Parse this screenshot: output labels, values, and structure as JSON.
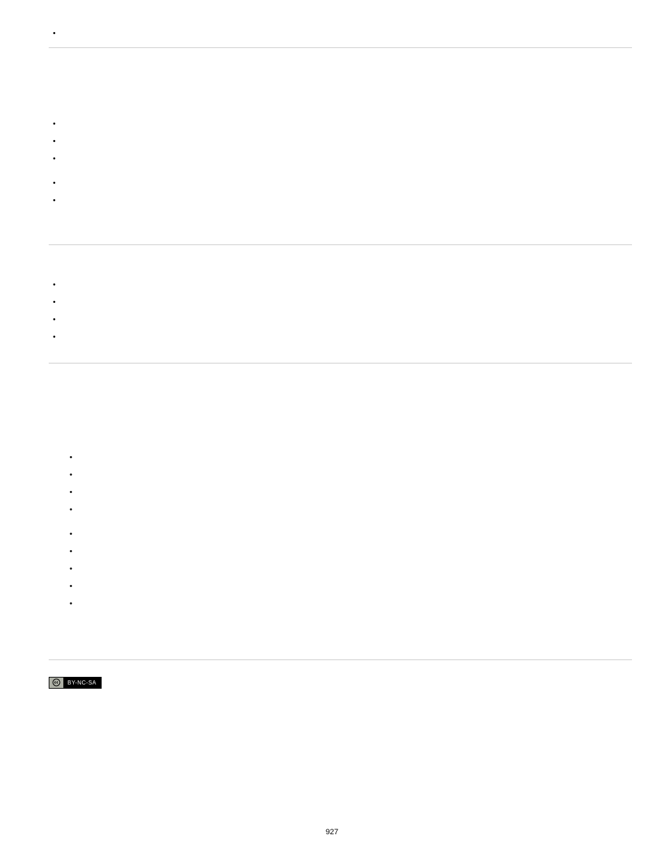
{
  "top_item": "",
  "section1": {
    "title": "",
    "sub": "",
    "intro": "",
    "groupA": [
      "",
      "",
      ""
    ],
    "groupB": [
      "",
      ""
    ],
    "tail": ""
  },
  "section2": {
    "title": "",
    "items": [
      "",
      "",
      "",
      ""
    ]
  },
  "section3": {
    "title": "",
    "sub1": "",
    "sub2": "",
    "intro": "",
    "groupA": [
      "",
      "",
      "",
      ""
    ],
    "groupB": [
      "",
      "",
      "",
      "",
      ""
    ],
    "tail": ""
  },
  "license_text": "BY-NC-SA",
  "page_number": "927"
}
